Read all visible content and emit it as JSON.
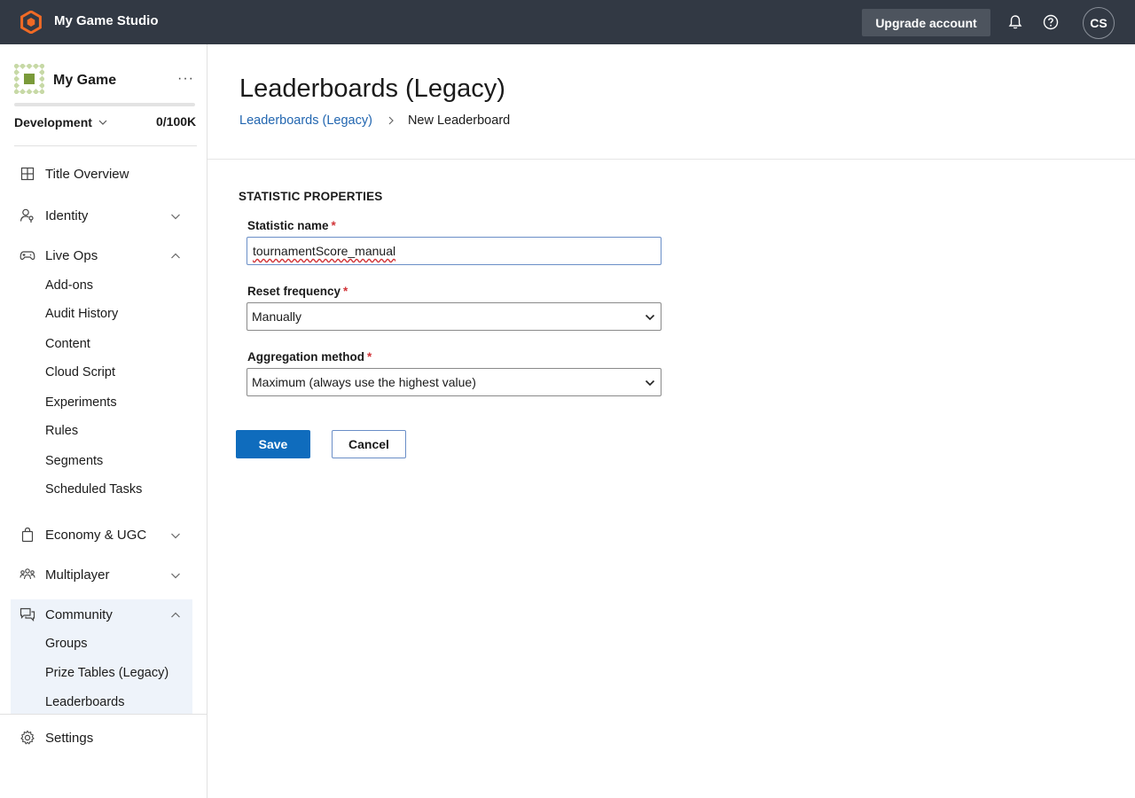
{
  "topbar": {
    "studio_name": "My Game Studio",
    "upgrade_label": "Upgrade account",
    "avatar_initials": "CS",
    "icons": [
      "hexagon-logo-icon",
      "bell-icon",
      "help-icon"
    ],
    "brand_color": "#f06a25",
    "bar_color": "#323944"
  },
  "sidebar": {
    "game_name": "My Game",
    "more_label": "···",
    "environment": "Development",
    "quota": "0/100K",
    "nav": {
      "title_overview": "Title Overview",
      "identity": "Identity",
      "live_ops": "Live Ops",
      "live_ops_items": [
        "Add-ons",
        "Audit History",
        "Content",
        "Cloud Script",
        "Experiments",
        "Rules",
        "Segments",
        "Scheduled Tasks"
      ],
      "economy": "Economy & UGC",
      "multiplayer": "Multiplayer",
      "community": "Community",
      "community_items": [
        "Groups",
        "Prize Tables (Legacy)",
        "Leaderboards"
      ],
      "settings": "Settings"
    }
  },
  "main": {
    "title": "Leaderboards (Legacy)",
    "breadcrumb": {
      "link": "Leaderboards (Legacy)",
      "current": "New Leaderboard"
    },
    "section_title": "STATISTIC PROPERTIES",
    "form": {
      "statistic_name_label": "Statistic name",
      "statistic_name_value": "tournamentScore_manual",
      "reset_frequency_label": "Reset frequency",
      "reset_frequency_value": "Manually",
      "aggregation_label": "Aggregation method",
      "aggregation_value": "Maximum (always use the highest value)",
      "required_mark": "*"
    },
    "actions": {
      "save": "Save",
      "cancel": "Cancel"
    }
  },
  "colors": {
    "primary": "#0f6cbd",
    "link": "#2266b0",
    "required": "#d13438",
    "active_bg": "#eef3fa"
  }
}
